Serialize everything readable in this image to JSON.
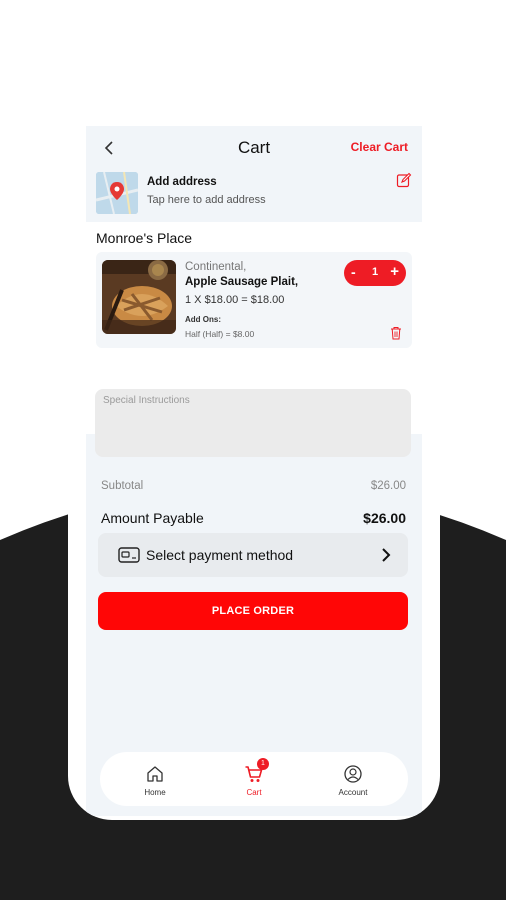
{
  "colors": {
    "accent": "#ee1c25",
    "place_order": "#ff0606",
    "backdrop": "#1e1e1e",
    "screen_bg": "#f1f5f9"
  },
  "header": {
    "title": "Cart",
    "clear_label": "Clear Cart",
    "back_icon": "chevron-left-icon"
  },
  "address": {
    "title": "Add address",
    "subtitle": "Tap here to add address",
    "edit_icon": "edit-icon"
  },
  "restaurant": {
    "name": "Monroe's Place"
  },
  "cart_item": {
    "category": "Continental,",
    "name": "Apple Sausage Plait,",
    "price_line": "1 X $18.00 = $18.00",
    "addons_label": "Add Ons:",
    "addons_value": "Half (Half) = $8.00",
    "quantity": "1",
    "minus": "-",
    "plus": "+"
  },
  "instructions": {
    "placeholder": "Special Instructions"
  },
  "summary": {
    "subtotal_label": "Subtotal",
    "subtotal_value": "$26.00",
    "payable_label": "Amount Payable",
    "payable_value": "$26.00"
  },
  "payment": {
    "label": "Select payment method"
  },
  "place_order": {
    "label": "PLACE ORDER"
  },
  "nav": {
    "home": {
      "label": "Home"
    },
    "cart": {
      "label": "Cart",
      "badge": "1"
    },
    "account": {
      "label": "Account"
    }
  }
}
